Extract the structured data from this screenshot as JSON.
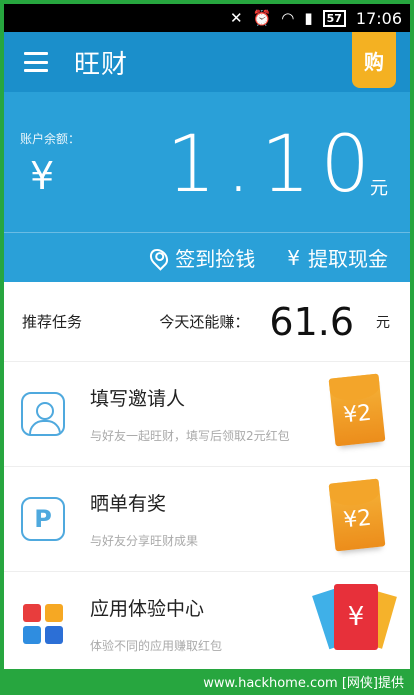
{
  "status_bar": {
    "time": "17:06",
    "battery": "57"
  },
  "header": {
    "title": "旺财",
    "buy_label": "购"
  },
  "balance": {
    "label": "账户余额：",
    "currency_symbol": "¥",
    "amount": "1.10",
    "unit": "元"
  },
  "actions": [
    {
      "label": "签到捡钱",
      "icon": "location-pin-icon"
    },
    {
      "label": "提取现金",
      "icon": "yen-icon"
    }
  ],
  "summary": {
    "title": "推荐任务",
    "earn_label": "今天还能赚：",
    "earn_value": "61.6",
    "earn_unit": "元"
  },
  "tasks": [
    {
      "title": "填写邀请人",
      "subtitle": "与好友一起旺财，填写后领取2元红包",
      "reward": "¥2"
    },
    {
      "title": "晒单有奖",
      "subtitle": "与好友分享旺财成果",
      "reward": "¥2"
    },
    {
      "title": "应用体验中心",
      "subtitle": "体验不同的应用赚取红包",
      "reward": "¥"
    }
  ],
  "colors": {
    "app_bar": "#1b8fcb",
    "balance_bg": "#2aa0d8",
    "badge": "#f4b122",
    "frame": "#27a63f"
  },
  "watermark": "www.hackhome.com [网侠]提供"
}
